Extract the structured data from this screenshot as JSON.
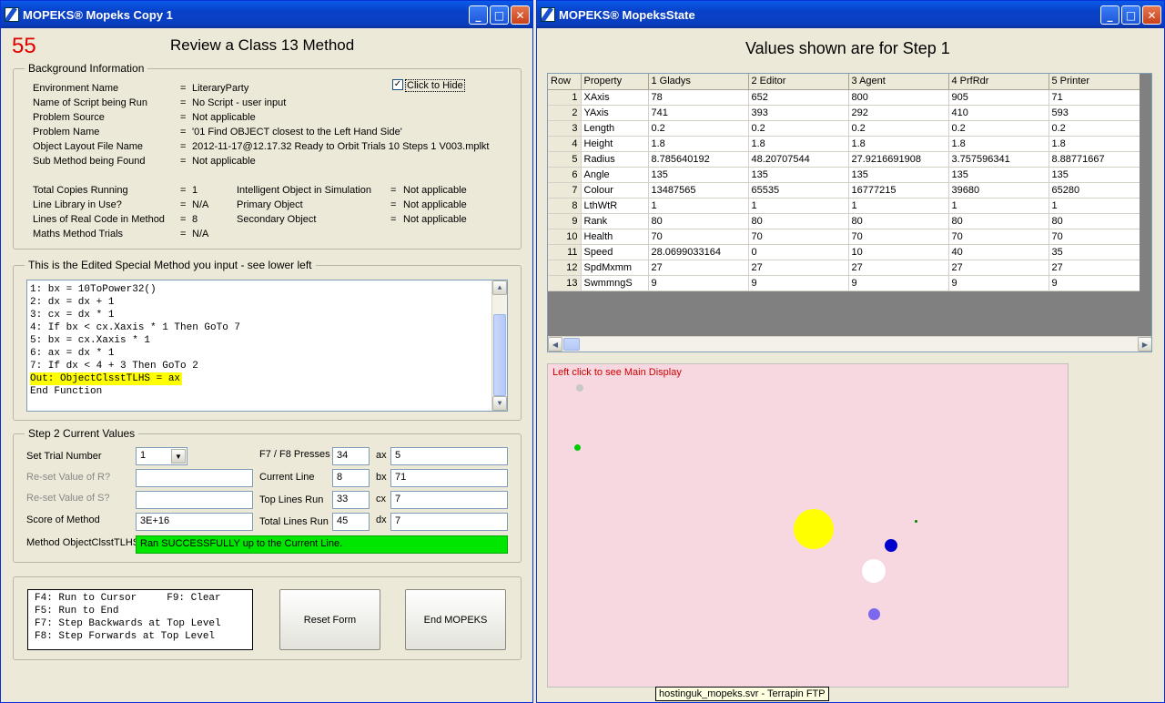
{
  "left_window": {
    "title": "MOPEKS® Mopeks Copy 1",
    "counter": "55",
    "heading": "Review a Class 13 Method",
    "background": {
      "title": "Background Information",
      "hide_label": "Click to Hide",
      "rows": [
        {
          "label": "Environment Name",
          "eq": "=",
          "value": "LiteraryParty"
        },
        {
          "label": "Name of Script being Run",
          "eq": "=",
          "value": "No Script - user input"
        },
        {
          "label": "Problem Source",
          "eq": "=",
          "value": "Not applicable"
        },
        {
          "label": "Problem Name",
          "eq": "=",
          "value": "'01  Find OBJECT closest to the Left Hand Side'"
        },
        {
          "label": "Object Layout File Name",
          "eq": "=",
          "value": "2012-11-17@12.17.32 Ready to Orbit Trials 10 Steps 1 V003.mplkt"
        },
        {
          "label": "Sub Method being Found",
          "eq": "=",
          "value": "Not applicable"
        }
      ],
      "rows2": [
        {
          "label": "Total Copies Running",
          "eq": "=",
          "value": "1",
          "label2": "Intelligent Object in Simulation",
          "eq2": "=",
          "value2": "Not applicable"
        },
        {
          "label": "Line Library in Use?",
          "eq": "=",
          "value": "N/A",
          "label2": "Primary Object",
          "eq2": "=",
          "value2": "Not applicable"
        },
        {
          "label": "Lines of Real Code in Method",
          "eq": "=",
          "value": "8",
          "label2": "Secondary Object",
          "eq2": "=",
          "value2": "Not applicable"
        },
        {
          "label": "Maths Method Trials",
          "eq": "=",
          "value": "N/A",
          "label2": "",
          "eq2": "",
          "value2": ""
        }
      ]
    },
    "method": {
      "title": "This is the Edited Special Method you input - see lower left",
      "lines": [
        "1: bx = 10ToPower32()",
        "2: dx = dx + 1",
        "3: cx = dx * 1",
        "4: If bx < cx.Xaxis * 1 Then GoTo 7",
        "5: bx = cx.Xaxis * 1",
        "6: ax = dx * 1",
        "7: If dx < 4 + 3 Then GoTo 2",
        "Out: ObjectClsstTLHS = ax",
        "End Function"
      ]
    },
    "step": {
      "title": "Step 2   Current Values",
      "trial_label": "Set Trial Number",
      "trial_value": "1",
      "reset_r_label": "Re-set Value of R?",
      "reset_s_label": "Re-set Value of S?",
      "score_label": "Score of Method",
      "score_value": "3E+16",
      "f7f8_label": "F7 / F8 Presses",
      "f7f8_value": "34",
      "current_line_label": "Current Line",
      "current_line_value": "8",
      "top_lines_label": "Top Lines Run",
      "top_lines_value": "33",
      "total_lines_label": "Total Lines Run",
      "total_lines_value": "45",
      "ax_label": "ax",
      "ax_value": "5",
      "bx_label": "bx",
      "bx_value": "71",
      "cx_label": "cx",
      "cx_value": "7",
      "dx_label": "dx",
      "dx_value": "7",
      "method_label": "Method ObjectClsstTLHS",
      "method_status": "Ran SUCCESSFULLY up to the Current Line."
    },
    "keys": {
      "lines": [
        "F4: Run to Cursor     F9: Clear",
        "F5: Run to End",
        "F7: Step Backwards at Top Level",
        "F8: Step Forwards at Top Level"
      ],
      "reset_button": "Reset Form",
      "end_button": "End MOPEKS"
    }
  },
  "right_window": {
    "title": "MOPEKS® MopeksState",
    "heading": "Values shown are for Step 1",
    "table": {
      "headers": [
        "Row",
        "Property",
        "1 Gladys",
        "2 Editor",
        "3 Agent",
        "4 PrfRdr",
        "5 Printer"
      ],
      "rows": [
        [
          "1",
          "XAxis",
          "78",
          "652",
          "800",
          "905",
          "71"
        ],
        [
          "2",
          "YAxis",
          "741",
          "393",
          "292",
          "410",
          "593"
        ],
        [
          "3",
          "Length",
          "0.2",
          "0.2",
          "0.2",
          "0.2",
          "0.2"
        ],
        [
          "4",
          "Height",
          "1.8",
          "1.8",
          "1.8",
          "1.8",
          "1.8"
        ],
        [
          "5",
          "Radius",
          "8.785640192",
          "48.20707544",
          "27.9216691908",
          "3.757596341",
          "8.88771667"
        ],
        [
          "6",
          "Angle",
          "135",
          "135",
          "135",
          "135",
          "135"
        ],
        [
          "7",
          "Colour",
          "13487565",
          "65535",
          "16777215",
          "39680",
          "65280"
        ],
        [
          "8",
          "LthWtR",
          "1",
          "1",
          "1",
          "1",
          "1"
        ],
        [
          "9",
          "Rank",
          "80",
          "80",
          "80",
          "80",
          "80"
        ],
        [
          "10",
          "Health",
          "70",
          "70",
          "70",
          "70",
          "70"
        ],
        [
          "11",
          "Speed",
          "28.0699033164",
          "0",
          "10",
          "40",
          "35"
        ],
        [
          "12",
          "SpdMxmm",
          "27",
          "27",
          "27",
          "27",
          "27"
        ],
        [
          "13",
          "SwmmngS",
          "9",
          "9",
          "9",
          "9",
          "9"
        ]
      ]
    },
    "display_hint": "Left click to see Main Display",
    "colors": {
      "canvas": "#f7d8e0",
      "yellow": "#ffff00",
      "blue": "#0000cc",
      "white": "#ffffff",
      "purple": "#7b68ee",
      "green": "#00cc00",
      "grey": "#c8c8c8"
    }
  },
  "tooltip": "hostinguk_mopeks.svr - Terrapin FTP"
}
